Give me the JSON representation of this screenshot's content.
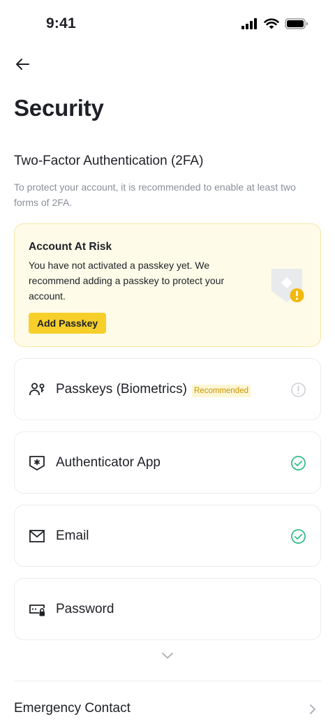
{
  "status_bar": {
    "time": "9:41",
    "icons": [
      "signal-icon",
      "wifi-icon",
      "battery-icon"
    ]
  },
  "nav": {
    "back_icon": "arrow-left-icon"
  },
  "page": {
    "title": "Security"
  },
  "two_factor": {
    "title": "Two-Factor Authentication (2FA)",
    "description": "To protect your account, it is recommended to enable at least two forms of 2FA."
  },
  "risk_card": {
    "title": "Account At Risk",
    "text": "You have not activated a passkey yet. We recommend adding a passkey to protect your account.",
    "button_label": "Add Passkey",
    "illustration": "shield-warning-icon"
  },
  "options": [
    {
      "label": "Passkeys (Biometrics)",
      "badge": "Recommended",
      "icon": "user-key-icon",
      "status": "warning"
    },
    {
      "label": "Authenticator App",
      "icon": "authenticator-shield-icon",
      "status": "enabled"
    },
    {
      "label": "Email",
      "icon": "envelope-icon",
      "status": "enabled"
    },
    {
      "label": "Password",
      "icon": "password-lock-icon",
      "status": "none"
    }
  ],
  "more": {
    "icon": "chevron-down-icon"
  },
  "emergency": {
    "label": "Emergency Contact",
    "icon": "chevron-right-icon"
  },
  "colors": {
    "accent": "#F6CF2A",
    "success": "#2EBD85",
    "warning": "#F0B90B",
    "text": "#1E2026",
    "muted": "#8A8F98",
    "border": "#EAECEF",
    "risk_bg": "#FEFBE8"
  }
}
